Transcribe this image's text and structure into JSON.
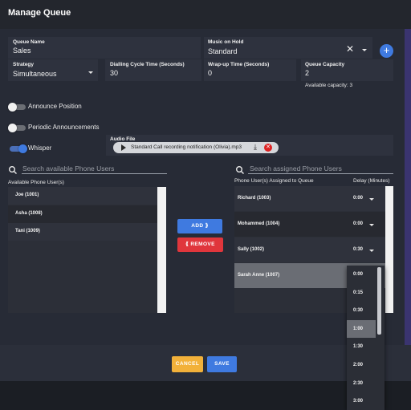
{
  "dialog": {
    "title": "Manage Queue"
  },
  "queue_name": {
    "label": "Queue Name",
    "value": "Sales"
  },
  "music_on_hold": {
    "label": "Music on Hold",
    "value": "Standard"
  },
  "strategy": {
    "label": "Strategy",
    "value": "Simultaneous"
  },
  "dialling_cycle": {
    "label": "Dialling Cycle Time (Seconds)",
    "value": "30"
  },
  "wrap_up": {
    "label": "Wrap-up Time (Seconds)",
    "value": "0"
  },
  "capacity": {
    "label": "Queue Capacity",
    "value": "2",
    "available": "Available capacity: 3"
  },
  "toggles": {
    "announce_position": {
      "label": "Announce Position",
      "on": false
    },
    "periodic_announcements": {
      "label": "Periodic Announcements",
      "on": false
    },
    "whisper": {
      "label": "Whisper",
      "on": true
    }
  },
  "audio": {
    "label": "Audio File",
    "file_name": "Standard Call recording notification (Olivia).mp3"
  },
  "available": {
    "search_placeholder": "Search available Phone Users",
    "header": "Available Phone User(s)",
    "users": [
      "Joe (1001)",
      "Asha (1008)",
      "Tani (1009)"
    ]
  },
  "assigned": {
    "search_placeholder": "Search assigned Phone Users",
    "header": "Phone User(s) Assigned to Queue",
    "delay_header": "Delay (Minutes)",
    "users": [
      {
        "name": "Richard (1003)",
        "delay": "0:00"
      },
      {
        "name": "Mohammed (1004)",
        "delay": "0:00"
      },
      {
        "name": "Sally (1002)",
        "delay": "0:30"
      },
      {
        "name": "Sarah Anne (1007)",
        "delay": ""
      }
    ]
  },
  "buttons": {
    "add": "ADD ⟫",
    "remove": "⟪ REMOVE",
    "cancel": "CANCEL",
    "save": "SAVE"
  },
  "delay_options": [
    "0:00",
    "0:15",
    "0:30",
    "1:00",
    "1:30",
    "2:00",
    "2:30",
    "3:00"
  ],
  "delay_selected": "1:00",
  "colors": {
    "accent": "#3f7ae0",
    "add": "#3f7ae0",
    "remove": "#e0363c",
    "cancel": "#f2b13a",
    "save": "#3f7ae0"
  }
}
